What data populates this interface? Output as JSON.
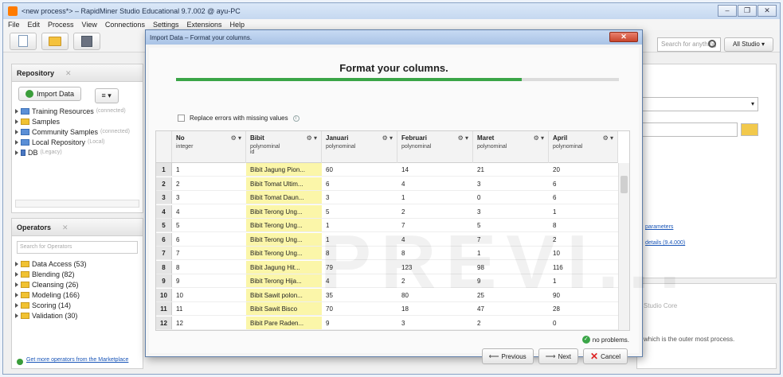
{
  "window": {
    "title": "<new process*> – RapidMiner Studio Educational 9.7.002 @ ayu-PC",
    "controls": [
      "–",
      "❐",
      "✕"
    ]
  },
  "menu": [
    "File",
    "Edit",
    "Process",
    "View",
    "Connections",
    "Settings",
    "Extensions",
    "Help"
  ],
  "toolbar": {
    "search_placeholder": "Search for anything",
    "studio_button": "All Studio ▾"
  },
  "repository": {
    "tab_label": "Repository",
    "import_label": "Import Data",
    "menu_label": "≡ ▾",
    "items": [
      {
        "label": "Training Resources",
        "note": "(connected)"
      },
      {
        "label": "Samples",
        "note": ""
      },
      {
        "label": "Community Samples",
        "note": "(connected)"
      },
      {
        "label": "Local Repository",
        "note": "(Local)"
      },
      {
        "label": "DB",
        "note": "(Legacy)"
      }
    ]
  },
  "operators": {
    "tab_label": "Operators",
    "search_placeholder": "Search for Operators",
    "items": [
      "Data Access (53)",
      "Blending (82)",
      "Cleansing (26)",
      "Modeling (166)",
      "Scoring (14)",
      "Validation (30)"
    ],
    "marketplace_link": "Get more operators from the Marketplace"
  },
  "right_panel": {
    "link1": "parameters",
    "link2": "details (9.4.000)",
    "core_label": "Studio Core",
    "desc": "which is the outer most process."
  },
  "dialog": {
    "title": "Import Data – Format your columns.",
    "close": "✕",
    "heading": "Format your columns.",
    "progress": 0.78,
    "replace_label": "Replace errors with missing values",
    "info_icon": "i",
    "watermark": "PREVI...",
    "status": "no problems.",
    "buttons": {
      "previous": "Previous",
      "next": "Next",
      "cancel": "Cancel"
    }
  },
  "table": {
    "columns": [
      {
        "name": "No",
        "type": "integer",
        "role": ""
      },
      {
        "name": "Bibit",
        "type": "polynominal",
        "role": "id"
      },
      {
        "name": "Januari",
        "type": "polynominal",
        "role": ""
      },
      {
        "name": "Februari",
        "type": "polynominal",
        "role": ""
      },
      {
        "name": "Maret",
        "type": "polynominal",
        "role": ""
      },
      {
        "name": "April",
        "type": "polynominal",
        "role": ""
      }
    ],
    "rows": [
      [
        "1",
        "1",
        "Bibit Jagung Pion...",
        "60",
        "14",
        "21",
        "20"
      ],
      [
        "2",
        "2",
        "Bibit Tomat Ultim...",
        "6",
        "4",
        "3",
        "6"
      ],
      [
        "3",
        "3",
        "Bibit Tomat Daun...",
        "3",
        "1",
        "0",
        "6"
      ],
      [
        "4",
        "4",
        "Bibit Terong Ung...",
        "5",
        "2",
        "3",
        "1"
      ],
      [
        "5",
        "5",
        "Bibit Terong Ung...",
        "1",
        "7",
        "5",
        "8"
      ],
      [
        "6",
        "6",
        "Bibit Terong Ung...",
        "1",
        "4",
        "7",
        "2"
      ],
      [
        "7",
        "7",
        "Bibit Terong Ung...",
        "8",
        "8",
        "1",
        "10"
      ],
      [
        "8",
        "8",
        "Bibit Jagung Hit...",
        "79",
        "123",
        "98",
        "116"
      ],
      [
        "9",
        "9",
        "Bibit Terong Hija...",
        "4",
        "2",
        "9",
        "1"
      ],
      [
        "10",
        "10",
        "Bibit Sawit polon...",
        "35",
        "80",
        "25",
        "90"
      ],
      [
        "11",
        "11",
        "Bibit Sawit Bisco",
        "70",
        "18",
        "47",
        "28"
      ],
      [
        "12",
        "12",
        "Bibit Pare Raden...",
        "9",
        "3",
        "2",
        "0"
      ]
    ]
  }
}
